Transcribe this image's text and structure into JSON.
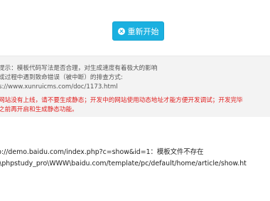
{
  "toolbar": {
    "restart_label": "重新开始",
    "restart_icon": "close-circle-icon"
  },
  "tips": {
    "line1": "提示：模板代码写法是否合理，对生成速度有着极大的影响",
    "line2": "成过程中遇到致命错误（被中断）的排查方式:",
    "line3": "s://www.xunruicms.com/doc/1173.html",
    "line4": "网站没有上线，请不要生成静态；开发中的网站使用动态地址才能方便开发调试；开发完毕",
    "line5": "之前再开启和生成静态功能。"
  },
  "result": {
    "line1": "p://demo.baidu.com/index.php?c=show&id=1：模板文件不存在",
    "line2": ":\\phpstudy_pro\\WWW\\baidu.com/template/pc/default/home/article/show.ht"
  },
  "colors": {
    "button": "#1ab0e0",
    "error_text": "#e01e1e",
    "panel_bg": "#f3f3f3"
  }
}
